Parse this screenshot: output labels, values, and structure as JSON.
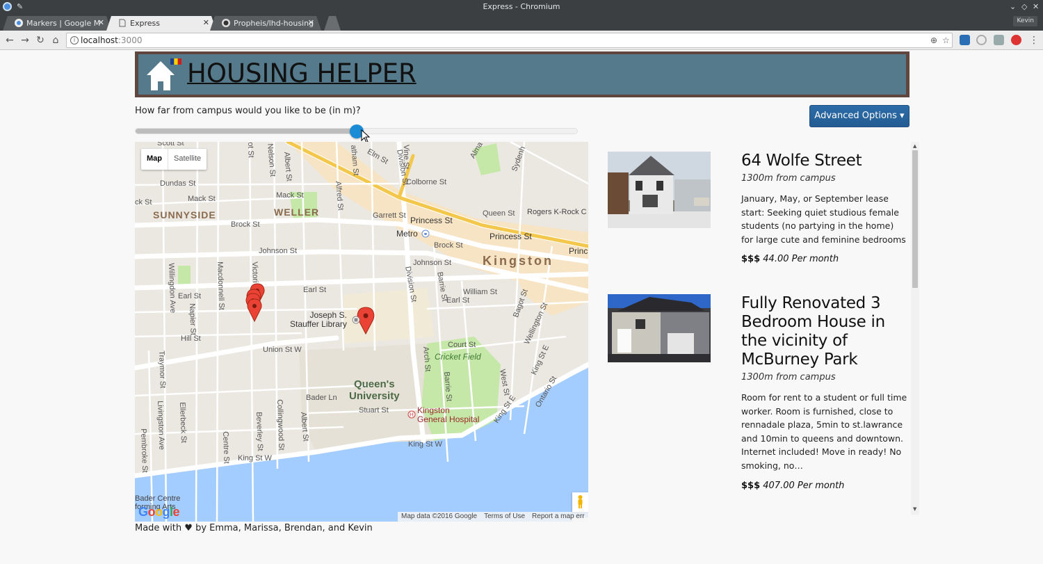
{
  "window": {
    "title": "Express - Chromium",
    "profile": "Kevin"
  },
  "tabs": [
    {
      "label": "Markers | Google M",
      "active": false
    },
    {
      "label": "Express",
      "active": true
    },
    {
      "label": "Propheis/lhd-housing",
      "active": false
    }
  ],
  "address_bar": {
    "host": "localhost",
    "port": ":3000"
  },
  "header": {
    "title": " HOUSING HELPER"
  },
  "distance": {
    "label": "How far from campus would you like to be (in m)?",
    "slider_fraction": 0.5
  },
  "advanced_options": {
    "label": "Advanced Options ▾"
  },
  "map": {
    "type_buttons": [
      "Map",
      "Satellite"
    ],
    "footer": [
      "Map data ©2016 Google",
      "Terms of Use",
      "Report a map err"
    ],
    "logo": "Google",
    "zoom_in": "+",
    "zoom_out": "−",
    "labels": {
      "sunnyside": "SUNNYSIDE",
      "weller": "WELLER",
      "kingston": "Kingston",
      "metro": "Metro",
      "library": "Joseph S.\nStauffer Library",
      "queens": "Queen's\nUniversity",
      "hospital": "Kingston\nGeneral Hospital",
      "cricket": "Cricket Field",
      "rogers": "Rogers K-Rock C",
      "bader": "Bader Centre\nforming Arts",
      "scott": "Scott St",
      "dundas": "Dundas St",
      "mack1": "Mack St",
      "mack2": "Mack St",
      "ck": "ck St",
      "brock1": "Brock St",
      "brock2": "Brock St",
      "johnson1": "Johnson St",
      "johnson2": "Johnson St",
      "earl1": "Earl St",
      "earl2": "Earl St",
      "earl3": "Earl St",
      "hill": "Hill St",
      "union": "Union St W",
      "garrett": "Garrett St",
      "queen": "Queen St",
      "princess1": "Princess St",
      "princess2": "Princess St",
      "princ": "Princ",
      "colborne": "Colborne St",
      "william": "William St",
      "court": "Court St",
      "stuart": "Stuart St",
      "bader_ln": "Bader Ln",
      "kingw1": "King St W",
      "kingw2": "King St W",
      "kinge1": "King St E",
      "kinge2": "King St E",
      "elm": "Elm St",
      "alma": "Alma St",
      "sydenh": "Sydenh",
      "vine": "Vine St",
      "division1": "Division St",
      "division2": "Division St",
      "barrie1": "Barrie St",
      "barrie2": "Barrie St",
      "arch": "Arch St",
      "westst": "West St",
      "ontario": "Ontario St",
      "bagot": "Bagot St",
      "wellington": "Wellington St",
      "albert1": "Albert St",
      "albert2": "Albert St",
      "alfred": "Alfred St",
      "athamst": "atham St",
      "nelson": "Nelson St",
      "victoria": "Victori",
      "macdonnell": "Macdonnell St",
      "napier": "Napier St",
      "willingdon": "Willingdon Ave",
      "traymor": "Traymor St",
      "livingston": "Livingston Ave",
      "ellerbeck": "Ellerbeck St",
      "pembroke": "Pembroke St",
      "centre": "Centre St",
      "beverley": "Beverley St",
      "collingwood": "Collingwood St",
      "ost": "ot St"
    },
    "markers": [
      {
        "name": "cluster-a"
      },
      {
        "name": "cluster-b"
      },
      {
        "name": "cluster-c"
      },
      {
        "name": "cluster-d"
      },
      {
        "name": "library-marker"
      }
    ]
  },
  "listings": [
    {
      "title": "64 Wolfe Street",
      "distance": "1300m from campus",
      "description": "January, May, or September lease start: Seeking quiet studious female students (no partying in the home) for large cute and feminine bedrooms",
      "price_sign": "$$$",
      "price": "44.00 Per month"
    },
    {
      "title": "Fully Renovated 3 Bedroom House in the vicinity of McBurney Park",
      "distance": "1300m from campus",
      "description": "Room for rent to a student or full time worker. Room is furnished, close to rennadale plaza, 5min to st.lawrance and 10min to queens and downtown. Internet included! Move in ready! No smoking, no…",
      "price_sign": "$$$",
      "price": "407.00 Per month"
    }
  ],
  "footer": {
    "text": "Made with ♥ by Emma, Marissa, Brendan, and Kevin"
  },
  "colors": {
    "banner_outer": "#5f463f",
    "banner_inner": "#557a8b",
    "button": "#245c93",
    "slider_thumb": "#1a8bd4"
  }
}
